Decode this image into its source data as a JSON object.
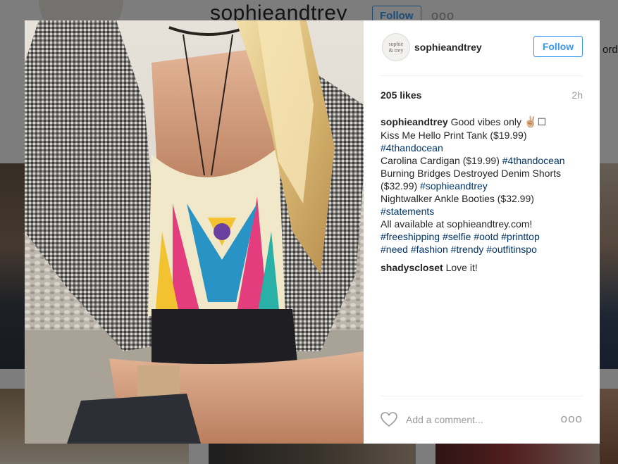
{
  "background": {
    "username": "sophieandtrey",
    "follow_label": "Follow",
    "more_label": "ooo",
    "right_partial_text": "ord"
  },
  "modal": {
    "header": {
      "avatar_text_line1": "sophie",
      "avatar_text_line2": "& trey",
      "username": "sophieandtrey",
      "follow_label": "Follow"
    },
    "likes": "205 likes",
    "time": "2h",
    "caption": {
      "username": "sophieandtrey",
      "line1": "Good vibes only",
      "emoji": "✌🏼",
      "box": "☐",
      "line2": "Kiss Me Hello Print Tank ($19.99)",
      "tag1": "#4thandocean",
      "line3": "Carolina Cardigan ($19.99)",
      "tag2": "#4thandocean",
      "line4": "Burning Bridges Destroyed Denim Shorts",
      "line5": "($32.99)",
      "tag3": "#sophieandtrey",
      "line6": "Nightwalker Ankle Booties ($32.99)",
      "tag4": "#statements",
      "line7": "All available at sophieandtrey.com!",
      "tags_row1": [
        "#freeshipping",
        "#selfie",
        "#ootd",
        "#printtop"
      ],
      "tags_row2": [
        "#need",
        "#fashion",
        "#trendy",
        "#outfitinspo"
      ]
    },
    "comment": {
      "username": "shadyscloset",
      "text": "Love it!"
    },
    "footer": {
      "add_comment_placeholder": "Add a comment...",
      "more_label": "ooo"
    }
  },
  "colors": {
    "accent": "#3897f0",
    "hashtag": "#003569",
    "muted": "#999999"
  }
}
